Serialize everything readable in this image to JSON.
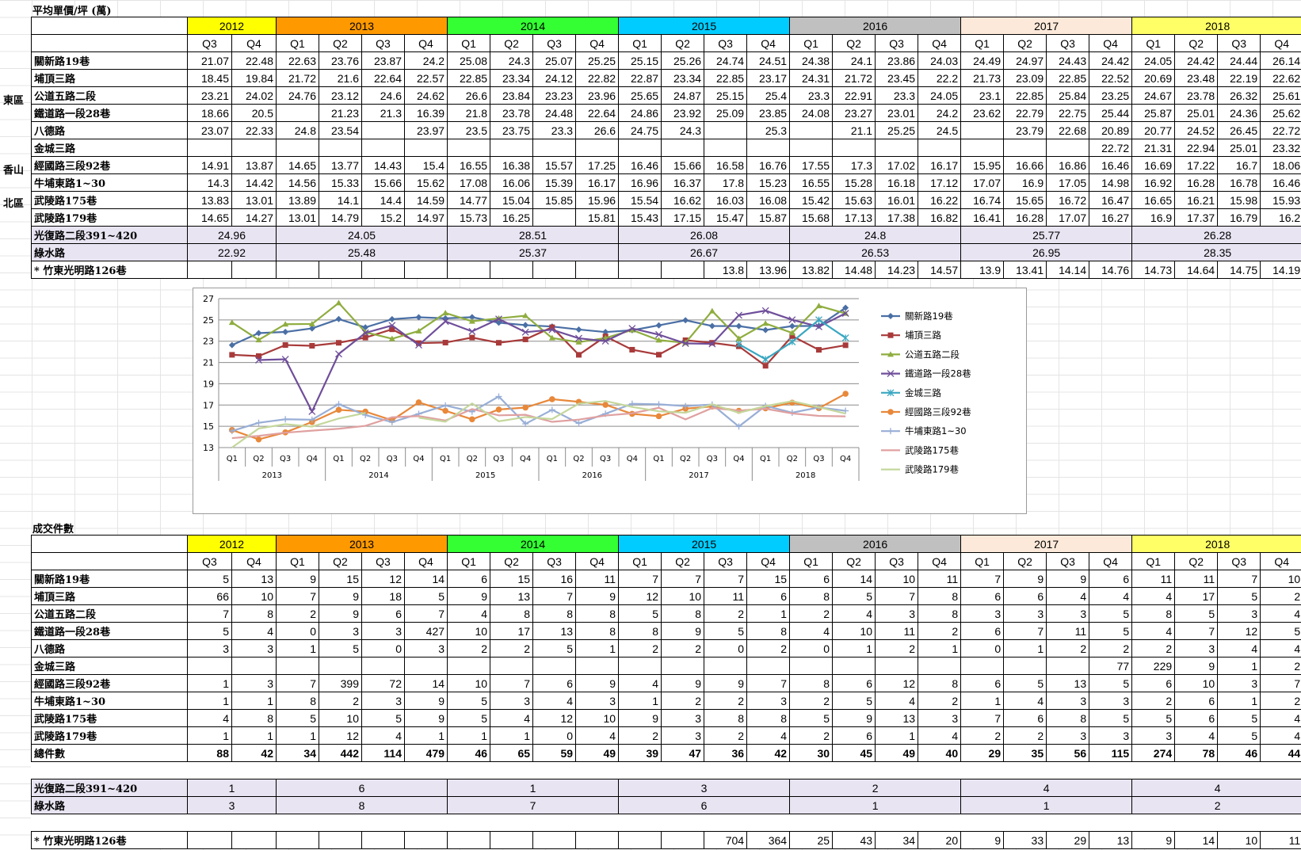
{
  "price_title": "平均單價/坪 (萬)",
  "count_title": "成交件數",
  "years": [
    {
      "label": "2012",
      "color": "#ffff00",
      "span": 2
    },
    {
      "label": "2013",
      "color": "#ff9900",
      "span": 4
    },
    {
      "label": "2014",
      "color": "#33ff33",
      "span": 4
    },
    {
      "label": "2015",
      "color": "#00ccff",
      "span": 4
    },
    {
      "label": "2016",
      "color": "#c0c0c0",
      "span": 4
    },
    {
      "label": "2017",
      "color": "#fde9d9",
      "span": 4
    },
    {
      "label": "2018",
      "color": "#ffff66",
      "span": 4
    }
  ],
  "quarters": [
    "Q3",
    "Q4",
    "Q1",
    "Q2",
    "Q3",
    "Q4",
    "Q1",
    "Q2",
    "Q3",
    "Q4",
    "Q1",
    "Q2",
    "Q3",
    "Q4",
    "Q1",
    "Q2",
    "Q3",
    "Q4",
    "Q1",
    "Q2",
    "Q3",
    "Q4",
    "Q1",
    "Q2",
    "Q3",
    "Q4"
  ],
  "regions": [
    {
      "label": "東區",
      "rows": 6
    },
    {
      "label": "香山",
      "rows": 2
    },
    {
      "label": "北區",
      "rows": 2
    }
  ],
  "price_rows": [
    {
      "name": "關新路19巷",
      "values": [
        "21.07",
        "22.48",
        "22.63",
        "23.76",
        "23.87",
        "24.2",
        "25.08",
        "24.3",
        "25.07",
        "25.25",
        "25.15",
        "25.26",
        "24.74",
        "24.51",
        "24.38",
        "24.1",
        "23.86",
        "24.03",
        "24.49",
        "24.97",
        "24.43",
        "24.42",
        "24.05",
        "24.42",
        "24.44",
        "26.14"
      ]
    },
    {
      "name": "埔頂三路",
      "values": [
        "18.45",
        "19.84",
        "21.72",
        "21.6",
        "22.64",
        "22.57",
        "22.85",
        "23.34",
        "24.12",
        "22.82",
        "22.87",
        "23.34",
        "22.85",
        "23.17",
        "24.31",
        "21.72",
        "23.45",
        "22.2",
        "21.73",
        "23.09",
        "22.85",
        "22.52",
        "20.69",
        "23.48",
        "22.19",
        "22.62"
      ]
    },
    {
      "name": "公道五路二段",
      "values": [
        "23.21",
        "24.02",
        "24.76",
        "23.12",
        "24.6",
        "24.62",
        "26.6",
        "23.84",
        "23.23",
        "23.96",
        "25.65",
        "24.87",
        "25.15",
        "25.4",
        "23.3",
        "22.91",
        "23.3",
        "24.05",
        "23.1",
        "22.85",
        "25.84",
        "23.25",
        "24.67",
        "23.78",
        "26.32",
        "25.61"
      ]
    },
    {
      "name": "鐵道路一段28巷",
      "values": [
        "18.66",
        "20.5",
        "",
        "21.23",
        "21.3",
        "16.39",
        "21.8",
        "23.78",
        "24.48",
        "22.64",
        "24.86",
        "23.92",
        "25.09",
        "23.85",
        "24.08",
        "23.27",
        "23.01",
        "24.2",
        "23.62",
        "22.79",
        "22.75",
        "25.44",
        "25.87",
        "25.01",
        "24.36",
        "25.62"
      ]
    },
    {
      "name": "八德路",
      "values": [
        "23.07",
        "22.33",
        "24.8",
        "23.54",
        "",
        "23.97",
        "23.5",
        "23.75",
        "23.3",
        "26.6",
        "24.75",
        "24.3",
        "",
        "25.3",
        "",
        "21.1",
        "25.25",
        "24.5",
        "",
        "23.79",
        "22.68",
        "20.89",
        "20.77",
        "24.52",
        "26.45",
        "22.72"
      ]
    },
    {
      "name": "金城三路",
      "values": [
        "",
        "",
        "",
        "",
        "",
        "",
        "",
        "",
        "",
        "",
        "",
        "",
        "",
        "",
        "",
        "",
        "",
        "",
        "",
        "",
        "",
        "22.72",
        "21.31",
        "22.94",
        "25.01",
        "23.32"
      ]
    },
    {
      "name": "經國路三段92巷",
      "values": [
        "14.91",
        "13.87",
        "14.65",
        "13.77",
        "14.43",
        "15.4",
        "16.55",
        "16.38",
        "15.57",
        "17.25",
        "16.46",
        "15.66",
        "16.58",
        "16.76",
        "17.55",
        "17.3",
        "17.02",
        "16.17",
        "15.95",
        "16.66",
        "16.86",
        "16.46",
        "16.69",
        "17.22",
        "16.7",
        "18.06"
      ]
    },
    {
      "name": "牛埔東路1~30",
      "values": [
        "14.3",
        "14.42",
        "14.56",
        "15.33",
        "15.66",
        "15.62",
        "17.08",
        "16.06",
        "15.39",
        "16.17",
        "16.96",
        "16.37",
        "17.8",
        "15.23",
        "16.55",
        "15.28",
        "16.18",
        "17.12",
        "17.07",
        "16.9",
        "17.05",
        "14.98",
        "16.92",
        "16.28",
        "16.78",
        "16.46"
      ]
    },
    {
      "name": "武陵路175巷",
      "values": [
        "13.83",
        "13.01",
        "13.89",
        "14.1",
        "14.4",
        "14.59",
        "14.77",
        "15.04",
        "15.85",
        "15.96",
        "15.54",
        "16.62",
        "16.03",
        "16.08",
        "15.42",
        "15.63",
        "16.01",
        "16.22",
        "16.74",
        "15.65",
        "16.72",
        "16.47",
        "16.65",
        "16.21",
        "15.98",
        "15.93"
      ]
    },
    {
      "name": "武陵路179巷",
      "values": [
        "14.65",
        "14.27",
        "13.01",
        "14.79",
        "15.2",
        "14.97",
        "15.73",
        "16.25",
        "",
        "15.81",
        "15.43",
        "17.15",
        "15.47",
        "15.87",
        "15.68",
        "17.13",
        "17.38",
        "16.82",
        "16.41",
        "16.28",
        "17.07",
        "16.27",
        "16.9",
        "17.37",
        "16.79",
        "16.2"
      ]
    }
  ],
  "price_extra": [
    {
      "name": "光復路二段391~420",
      "yearly": [
        "24.96",
        "24.05",
        "28.51",
        "26.08",
        "24.8",
        "25.77",
        "26.28"
      ]
    },
    {
      "name": "綠水路",
      "yearly": [
        "22.92",
        "25.48",
        "25.37",
        "26.67",
        "26.53",
        "26.95",
        "28.35"
      ]
    }
  ],
  "price_last": {
    "name": "* 竹東光明路126巷",
    "values": [
      "",
      "",
      "",
      "",
      "",
      "",
      "",
      "",
      "",
      "",
      "",
      "",
      "13.8",
      "13.96",
      "13.82",
      "14.48",
      "14.23",
      "14.57",
      "13.9",
      "13.41",
      "14.14",
      "14.76",
      "14.73",
      "14.64",
      "14.75",
      "14.19"
    ]
  },
  "count_rows": [
    {
      "name": "關新路19巷",
      "values": [
        "5",
        "13",
        "9",
        "15",
        "12",
        "14",
        "6",
        "15",
        "16",
        "11",
        "7",
        "7",
        "7",
        "15",
        "6",
        "14",
        "10",
        "11",
        "7",
        "9",
        "9",
        "6",
        "11",
        "11",
        "7",
        "10"
      ]
    },
    {
      "name": "埔頂三路",
      "values": [
        "66",
        "10",
        "7",
        "9",
        "18",
        "5",
        "9",
        "13",
        "7",
        "9",
        "12",
        "10",
        "11",
        "6",
        "8",
        "5",
        "7",
        "8",
        "6",
        "6",
        "4",
        "4",
        "4",
        "17",
        "5",
        "2"
      ]
    },
    {
      "name": "公道五路二段",
      "values": [
        "7",
        "8",
        "2",
        "9",
        "6",
        "7",
        "4",
        "8",
        "8",
        "8",
        "5",
        "8",
        "2",
        "1",
        "2",
        "4",
        "3",
        "8",
        "3",
        "3",
        "3",
        "5",
        "8",
        "5",
        "3",
        "4"
      ]
    },
    {
      "name": "鐵道路一段28巷",
      "values": [
        "5",
        "4",
        "0",
        "3",
        "3",
        "427",
        "10",
        "17",
        "13",
        "8",
        "8",
        "9",
        "5",
        "8",
        "4",
        "10",
        "11",
        "2",
        "6",
        "7",
        "11",
        "5",
        "4",
        "7",
        "12",
        "5"
      ]
    },
    {
      "name": "八德路",
      "values": [
        "3",
        "3",
        "1",
        "5",
        "0",
        "3",
        "2",
        "2",
        "5",
        "1",
        "2",
        "2",
        "0",
        "2",
        "0",
        "1",
        "2",
        "1",
        "0",
        "1",
        "2",
        "2",
        "2",
        "3",
        "4",
        "4"
      ]
    },
    {
      "name": "金城三路",
      "values": [
        "",
        "",
        "",
        "",
        "",
        "",
        "",
        "",
        "",
        "",
        "",
        "",
        "",
        "",
        "",
        "",
        "",
        "",
        "",
        "",
        "",
        "77",
        "229",
        "9",
        "1",
        "2"
      ]
    },
    {
      "name": "經國路三段92巷",
      "values": [
        "1",
        "3",
        "7",
        "399",
        "72",
        "14",
        "10",
        "7",
        "6",
        "9",
        "4",
        "9",
        "9",
        "7",
        "8",
        "6",
        "12",
        "8",
        "6",
        "5",
        "13",
        "5",
        "6",
        "10",
        "3",
        "7"
      ]
    },
    {
      "name": "牛埔東路1~30",
      "values": [
        "1",
        "1",
        "8",
        "2",
        "3",
        "9",
        "5",
        "3",
        "4",
        "3",
        "1",
        "2",
        "2",
        "3",
        "2",
        "5",
        "4",
        "2",
        "1",
        "4",
        "3",
        "3",
        "2",
        "6",
        "1",
        "2"
      ]
    },
    {
      "name": "武陵路175巷",
      "values": [
        "4",
        "8",
        "5",
        "10",
        "5",
        "9",
        "5",
        "4",
        "12",
        "10",
        "9",
        "3",
        "8",
        "8",
        "5",
        "9",
        "13",
        "3",
        "7",
        "6",
        "8",
        "5",
        "5",
        "6",
        "5",
        "4"
      ]
    },
    {
      "name": "武陵路179巷",
      "values": [
        "1",
        "1",
        "1",
        "12",
        "4",
        "1",
        "1",
        "1",
        "0",
        "4",
        "2",
        "3",
        "2",
        "4",
        "2",
        "6",
        "1",
        "4",
        "2",
        "2",
        "3",
        "3",
        "3",
        "4",
        "5",
        "4"
      ]
    }
  ],
  "count_total": {
    "name": "總件數",
    "values": [
      "88",
      "42",
      "34",
      "442",
      "114",
      "479",
      "46",
      "65",
      "59",
      "49",
      "39",
      "47",
      "36",
      "42",
      "30",
      "45",
      "49",
      "40",
      "29",
      "35",
      "56",
      "115",
      "274",
      "78",
      "46",
      "44"
    ]
  },
  "count_extra": [
    {
      "name": "光復路二段391~420",
      "yearly": [
        "1",
        "6",
        "1",
        "3",
        "2",
        "4",
        "4"
      ]
    },
    {
      "name": "綠水路",
      "yearly": [
        "3",
        "8",
        "7",
        "6",
        "1",
        "1",
        "2"
      ]
    }
  ],
  "count_last": {
    "name": "* 竹東光明路126巷",
    "values": [
      "",
      "",
      "",
      "",
      "",
      "",
      "",
      "",
      "",
      "",
      "",
      "",
      "704",
      "364",
      "25",
      "43",
      "34",
      "20",
      "9",
      "33",
      "29",
      "13",
      "9",
      "14",
      "10",
      "11"
    ]
  },
  "chart_data": {
    "type": "line",
    "title": "",
    "quarters": [
      "Q1",
      "Q2",
      "Q3",
      "Q4",
      "Q1",
      "Q2",
      "Q3",
      "Q4",
      "Q1",
      "Q2",
      "Q3",
      "Q4",
      "Q1",
      "Q2",
      "Q3",
      "Q4",
      "Q1",
      "Q2",
      "Q3",
      "Q4",
      "Q1",
      "Q2",
      "Q3",
      "Q4"
    ],
    "year_groups": [
      "2013",
      "2014",
      "2015",
      "2016",
      "2017",
      "2018"
    ],
    "yticks": [
      13,
      15,
      17,
      19,
      21,
      23,
      25,
      27
    ],
    "ylim": [
      13,
      27
    ],
    "grid": true,
    "legend_position": "right",
    "series": [
      {
        "name": "關新路19巷",
        "color": "#4a6fa5",
        "marker": "diamond",
        "values": [
          22.63,
          23.76,
          23.87,
          24.2,
          25.08,
          24.3,
          25.07,
          25.25,
          25.15,
          25.26,
          24.74,
          24.51,
          24.38,
          24.1,
          23.86,
          24.03,
          24.49,
          24.97,
          24.43,
          24.42,
          24.05,
          24.42,
          24.44,
          26.14
        ]
      },
      {
        "name": "埔頂三路",
        "color": "#a83a3a",
        "marker": "square",
        "values": [
          21.72,
          21.6,
          22.64,
          22.57,
          22.85,
          23.34,
          24.12,
          22.82,
          22.87,
          23.34,
          22.85,
          23.17,
          24.31,
          21.72,
          23.45,
          22.2,
          21.73,
          23.09,
          22.85,
          22.52,
          20.69,
          23.48,
          22.19,
          22.62
        ]
      },
      {
        "name": "公道五路二段",
        "color": "#8fad3f",
        "marker": "triangle",
        "values": [
          24.76,
          23.12,
          24.6,
          24.62,
          26.6,
          23.84,
          23.23,
          23.96,
          25.65,
          24.87,
          25.15,
          25.4,
          23.3,
          22.91,
          23.3,
          24.05,
          23.1,
          22.85,
          25.84,
          23.25,
          24.67,
          23.78,
          26.32,
          25.61
        ]
      },
      {
        "name": "鐵道路一段28巷",
        "color": "#6f4e9a",
        "marker": "x",
        "values": [
          null,
          21.23,
          21.3,
          16.39,
          21.8,
          23.78,
          24.48,
          22.64,
          24.86,
          23.92,
          25.09,
          23.85,
          24.08,
          23.27,
          23.01,
          24.2,
          23.62,
          22.79,
          22.75,
          25.44,
          25.87,
          25.01,
          24.36,
          25.62
        ]
      },
      {
        "name": "金城三路",
        "color": "#3aa7c1",
        "marker": "star",
        "values": [
          null,
          null,
          null,
          null,
          null,
          null,
          null,
          null,
          null,
          null,
          null,
          null,
          null,
          null,
          null,
          null,
          null,
          null,
          null,
          22.72,
          21.31,
          22.94,
          25.01,
          23.32
        ]
      },
      {
        "name": "經國路三段92巷",
        "color": "#e8883a",
        "marker": "circle",
        "values": [
          14.65,
          13.77,
          14.43,
          15.4,
          16.55,
          16.38,
          15.57,
          17.25,
          16.46,
          15.66,
          16.58,
          16.76,
          17.55,
          17.3,
          17.02,
          16.17,
          15.95,
          16.66,
          16.86,
          16.46,
          16.69,
          17.22,
          16.7,
          18.06
        ]
      },
      {
        "name": "牛埔東路1~30",
        "color": "#98aed6",
        "marker": "plus",
        "values": [
          14.56,
          15.33,
          15.66,
          15.62,
          17.08,
          16.06,
          15.39,
          16.17,
          16.96,
          16.37,
          17.8,
          15.23,
          16.55,
          15.28,
          16.18,
          17.12,
          17.07,
          16.9,
          17.05,
          14.98,
          16.92,
          16.28,
          16.78,
          16.46
        ]
      },
      {
        "name": "武陵路175巷",
        "color": "#e0a0a0",
        "marker": "none",
        "values": [
          13.89,
          14.1,
          14.4,
          14.59,
          14.77,
          15.04,
          15.85,
          15.96,
          15.54,
          16.62,
          16.03,
          16.08,
          15.42,
          15.63,
          16.01,
          16.22,
          16.74,
          15.65,
          16.72,
          16.47,
          16.65,
          16.21,
          15.98,
          15.93
        ]
      },
      {
        "name": "武陵路179巷",
        "color": "#c4d79b",
        "marker": "none",
        "values": [
          13.01,
          14.79,
          15.2,
          14.97,
          15.73,
          16.25,
          null,
          15.81,
          15.43,
          17.15,
          15.47,
          15.87,
          15.68,
          17.13,
          17.38,
          16.82,
          16.41,
          16.28,
          17.07,
          16.27,
          16.9,
          17.37,
          16.79,
          16.2
        ]
      }
    ]
  }
}
